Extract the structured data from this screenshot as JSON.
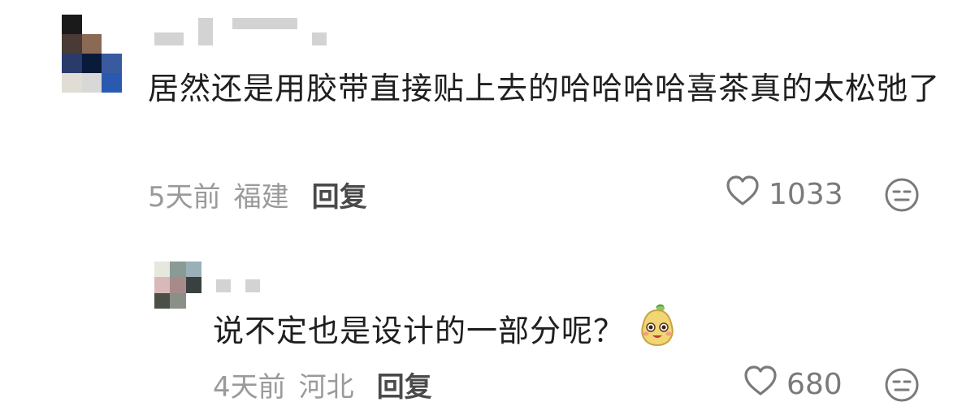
{
  "comments": [
    {
      "text": "居然还是用胶带直接贴上去的哈哈哈哈喜茶真的太松弛了",
      "time": "5天前",
      "location": "福建",
      "reply_label": "回复",
      "likes": "1033",
      "avatar_colors": [
        "#1a1a1a",
        "#ffffff",
        "#ffffff",
        "#4a3a35",
        "#8a6a55",
        "#ffffff",
        "#2a3a6a",
        "#0a1a3a",
        "#3a5aa0",
        "#e0ddd5",
        "#d8d8d8",
        "#2a5ab0"
      ]
    },
    {
      "text": "说不定也是设计的一部分呢？",
      "time": "4天前",
      "location": "河北",
      "reply_label": "回复",
      "likes": "680",
      "avatar_colors": [
        "#e6e8de",
        "#8a9a95",
        "#9ab0b8",
        "#d8b8b8",
        "#a88a8a",
        "#3a4040",
        "#4a5045",
        "#8a9088",
        "#ffffff"
      ]
    }
  ],
  "icons": {
    "like": "heart-outline-icon",
    "dislike": "meh-face-icon",
    "emoji": "smiling-pear-sticker"
  },
  "colors": {
    "text": "#1f1f1f",
    "meta": "#9a9a9a",
    "reply": "#4a4a4a",
    "icon": "#7a7a7a"
  }
}
